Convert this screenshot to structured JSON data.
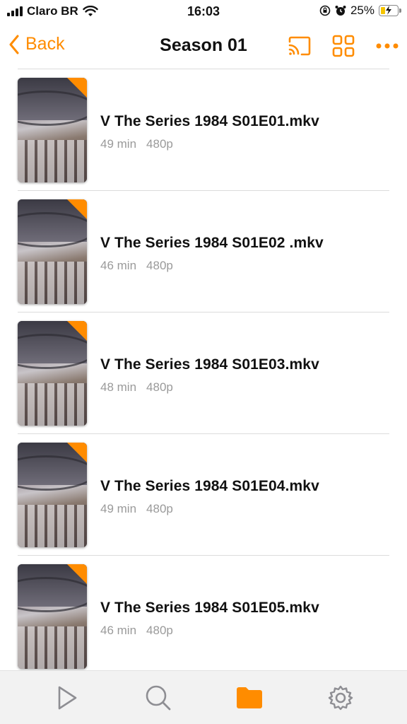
{
  "status_bar": {
    "carrier": "Claro BR",
    "time": "16:03",
    "battery": "25%",
    "icons": [
      "signal-icon",
      "wifi-icon",
      "orientation-lock-icon",
      "alarm-icon",
      "battery-icon"
    ]
  },
  "nav": {
    "back_label": "Back",
    "title": "Season 01",
    "actions": [
      "cast-icon",
      "grid-view-icon",
      "more-icon"
    ]
  },
  "accent_color": "#ff8c00",
  "episodes": [
    {
      "title": "V The Series 1984 S01E01.mkv",
      "duration": "49 min",
      "resolution": "480p"
    },
    {
      "title": "V The Series 1984 S01E02 .mkv",
      "duration": "46 min",
      "resolution": "480p"
    },
    {
      "title": "V The Series 1984 S01E03.mkv",
      "duration": "48 min",
      "resolution": "480p"
    },
    {
      "title": "V The Series 1984 S01E04.mkv",
      "duration": "49 min",
      "resolution": "480p"
    },
    {
      "title": "V The Series 1984 S01E05.mkv",
      "duration": "46 min",
      "resolution": "480p"
    }
  ],
  "tab_bar": {
    "tabs": [
      "play-icon",
      "search-icon",
      "folder-icon",
      "settings-icon"
    ],
    "active": "folder-icon"
  }
}
